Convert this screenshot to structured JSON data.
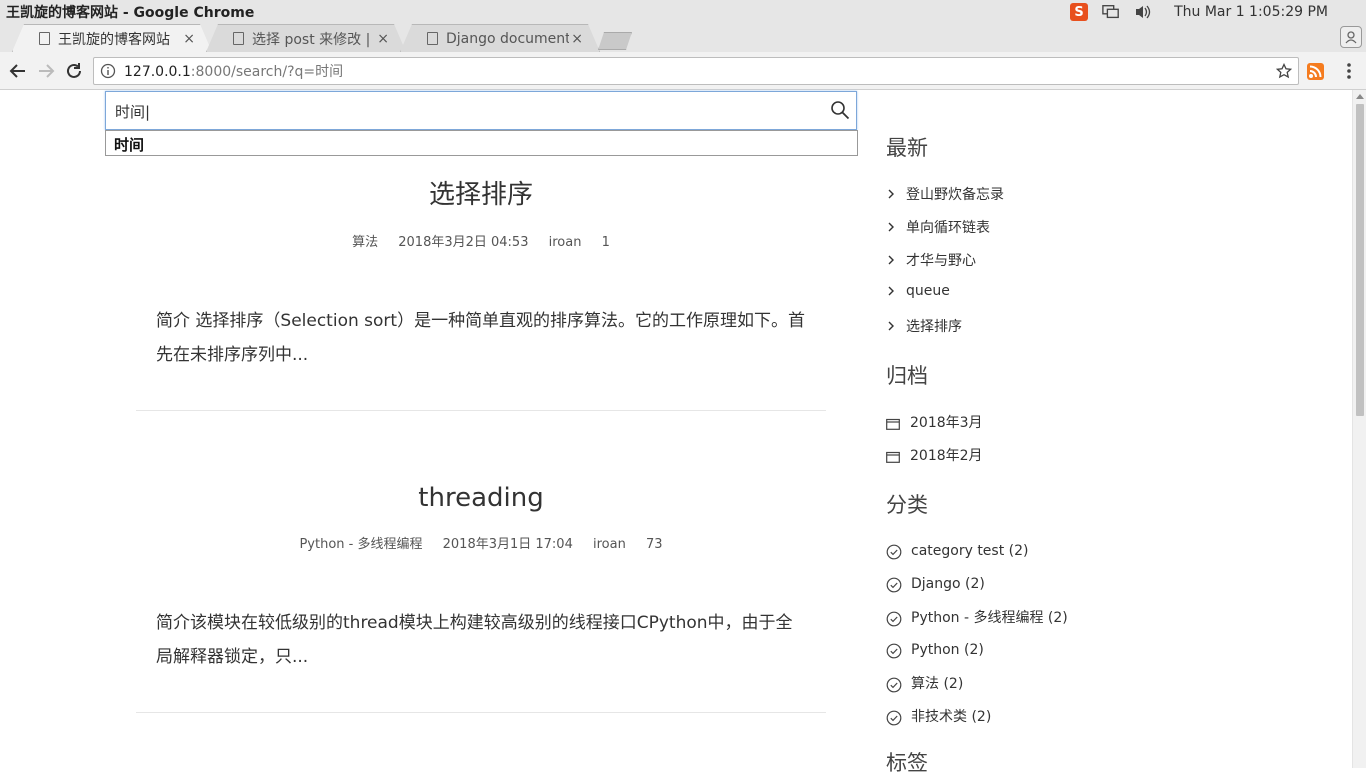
{
  "os": {
    "window_title": "王凯旋的博客网站 - Google Chrome",
    "tray_ime_label": "S",
    "clock": "Thu Mar  1  1:05:29 PM"
  },
  "tabs": [
    {
      "title": "王凯旋的博客网站",
      "close": "×"
    },
    {
      "title": "选择 post 来修改 | D",
      "close": "×"
    },
    {
      "title": "Django documenta",
      "close": "×"
    }
  ],
  "toolbar": {
    "url_host": "127.0.0.1",
    "url_rest": ":8000/search/?q=时间"
  },
  "search": {
    "value": "时间|",
    "suggestion": "时间"
  },
  "posts": [
    {
      "title": "选择排序",
      "category": "算法",
      "date": "2018年3月2日 04:53",
      "author": "iroan",
      "views": "1",
      "excerpt": "简介 选择排序（Selection sort）是一种简单直观的排序算法。它的工作原理如下。首先在未排序序列中..."
    },
    {
      "title": "threading",
      "category": "Python - 多线程编程",
      "date": "2018年3月1日 17:04",
      "author": "iroan",
      "views": "73",
      "excerpt": "简介该模块在较低级别的thread模块上构建较高级别的线程接口CPython中，由于全局解释器锁定，只..."
    }
  ],
  "sidebar": {
    "recent": {
      "heading": "最新",
      "items": [
        "登山野炊备忘录",
        "单向循环链表",
        "才华与野心",
        "queue",
        "选择排序"
      ]
    },
    "archive": {
      "heading": "归档",
      "items": [
        "2018年3月",
        "2018年2月"
      ]
    },
    "categories": {
      "heading": "分类",
      "items": [
        "category test (2)",
        "Django (2)",
        "Python - 多线程编程 (2)",
        "Python (2)",
        "算法 (2)",
        "非技术类 (2)"
      ]
    },
    "tags": {
      "heading": "标签"
    }
  }
}
